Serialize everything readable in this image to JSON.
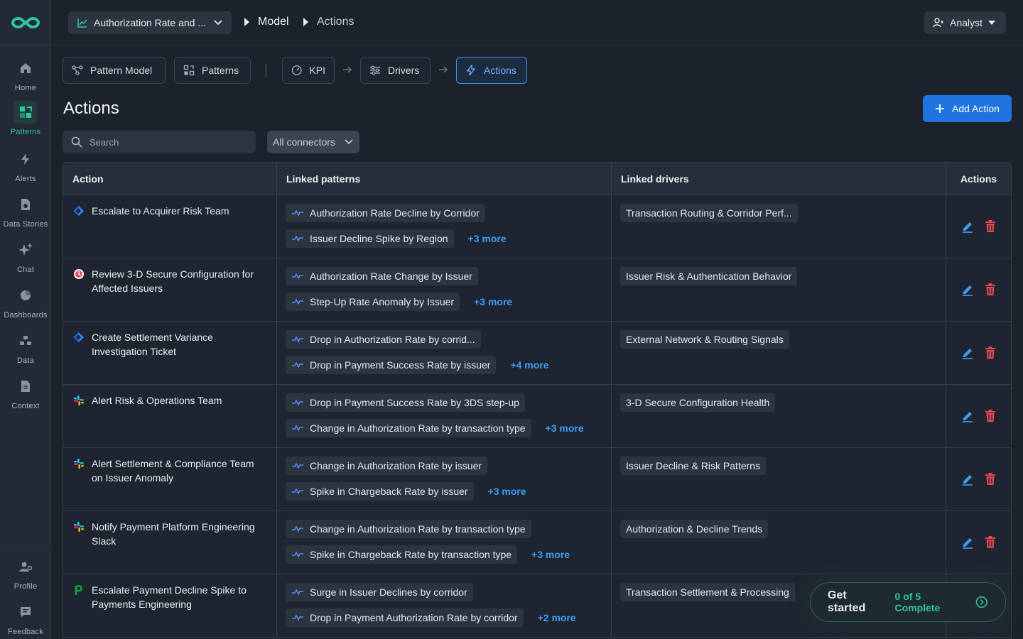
{
  "colors": {
    "accent": "#1f74e0",
    "brand": "#2ec4a6",
    "danger": "#e5484d",
    "link": "#3f9cf5"
  },
  "sidebar": {
    "logo": "infinity-logo",
    "items": [
      {
        "label": "Home",
        "icon": "home-icon"
      },
      {
        "label": "Patterns",
        "icon": "patterns-icon"
      },
      {
        "label": "Alerts",
        "icon": "bolt-icon"
      },
      {
        "label": "Data Stories",
        "icon": "data-stories-icon"
      },
      {
        "label": "Chat",
        "icon": "sparkle-icon"
      },
      {
        "label": "Dashboards",
        "icon": "pie-icon"
      },
      {
        "label": "Data",
        "icon": "data-icon"
      },
      {
        "label": "Context",
        "icon": "document-icon"
      }
    ],
    "bottom": [
      {
        "label": "Profile",
        "icon": "profile-icon"
      },
      {
        "label": "Feedback",
        "icon": "feedback-icon"
      }
    ]
  },
  "topbar": {
    "model_select": "Authorization Rate and ...",
    "crumbs": [
      "Model",
      "Actions"
    ],
    "role": "Analyst"
  },
  "tabs": [
    "Pattern Model",
    "Patterns",
    "KPI",
    "Drivers",
    "Actions"
  ],
  "page": {
    "title": "Actions",
    "add_button": "Add Action",
    "search_placeholder": "Search",
    "connector_filter": "All connectors"
  },
  "table": {
    "headers": [
      "Action",
      "Linked patterns",
      "Linked drivers",
      "Actions"
    ],
    "rows": [
      {
        "action": "Escalate to Acquirer Risk Team",
        "icon": "jira-icon",
        "patterns": [
          "Authorization Rate Decline by Corridor",
          "Issuer Decline Spike by Region"
        ],
        "more": "+3 more",
        "driver": "Transaction Routing & Corridor Perf..."
      },
      {
        "action": "Review 3-D Secure Configuration for Affected Issuers",
        "icon": "pagerduty-icon",
        "patterns": [
          "Authorization Rate Change by Issuer",
          "Step-Up Rate Anomaly by Issuer"
        ],
        "more": "+3 more",
        "driver": "Issuer Risk & Authentication Behavior"
      },
      {
        "action": "Create Settlement Variance Investigation Ticket",
        "icon": "jira-icon",
        "patterns": [
          "Drop in Authorization Rate by corrid...",
          "Drop in Payment Success Rate by issuer"
        ],
        "more": "+4 more",
        "driver": "External Network & Routing Signals"
      },
      {
        "action": "Alert Risk & Operations Team",
        "icon": "slack-icon",
        "patterns": [
          "Drop in Payment Success Rate by 3DS step-up",
          "Change in Authorization Rate by transaction type"
        ],
        "more": "+3 more",
        "driver": "3-D Secure Configuration Health"
      },
      {
        "action": "Alert Settlement & Compliance Team on Issuer Anomaly",
        "icon": "slack-icon",
        "patterns": [
          "Change in Authorization Rate by issuer",
          "Spike in Chargeback Rate by issuer"
        ],
        "more": "+3 more",
        "driver": "Issuer Decline & Risk Patterns"
      },
      {
        "action": "Notify Payment Platform Engineering Slack",
        "icon": "slack-icon",
        "patterns": [
          "Change in Authorization Rate by transaction type",
          "Spike in Chargeback Rate by transaction type"
        ],
        "more": "+3 more",
        "driver": "Authorization & Decline Trends"
      },
      {
        "action": "Escalate Payment Decline Spike to Payments Engineering",
        "icon": "pagerduty-p-icon",
        "patterns": [
          "Surge in Issuer Declines by corridor",
          "Drop in Payment Authorization Rate by corridor"
        ],
        "more": "+2 more",
        "driver": "Transaction Settlement & Processing"
      }
    ]
  },
  "get_started": {
    "title": "Get started",
    "progress": "0 of 5 Complete"
  }
}
